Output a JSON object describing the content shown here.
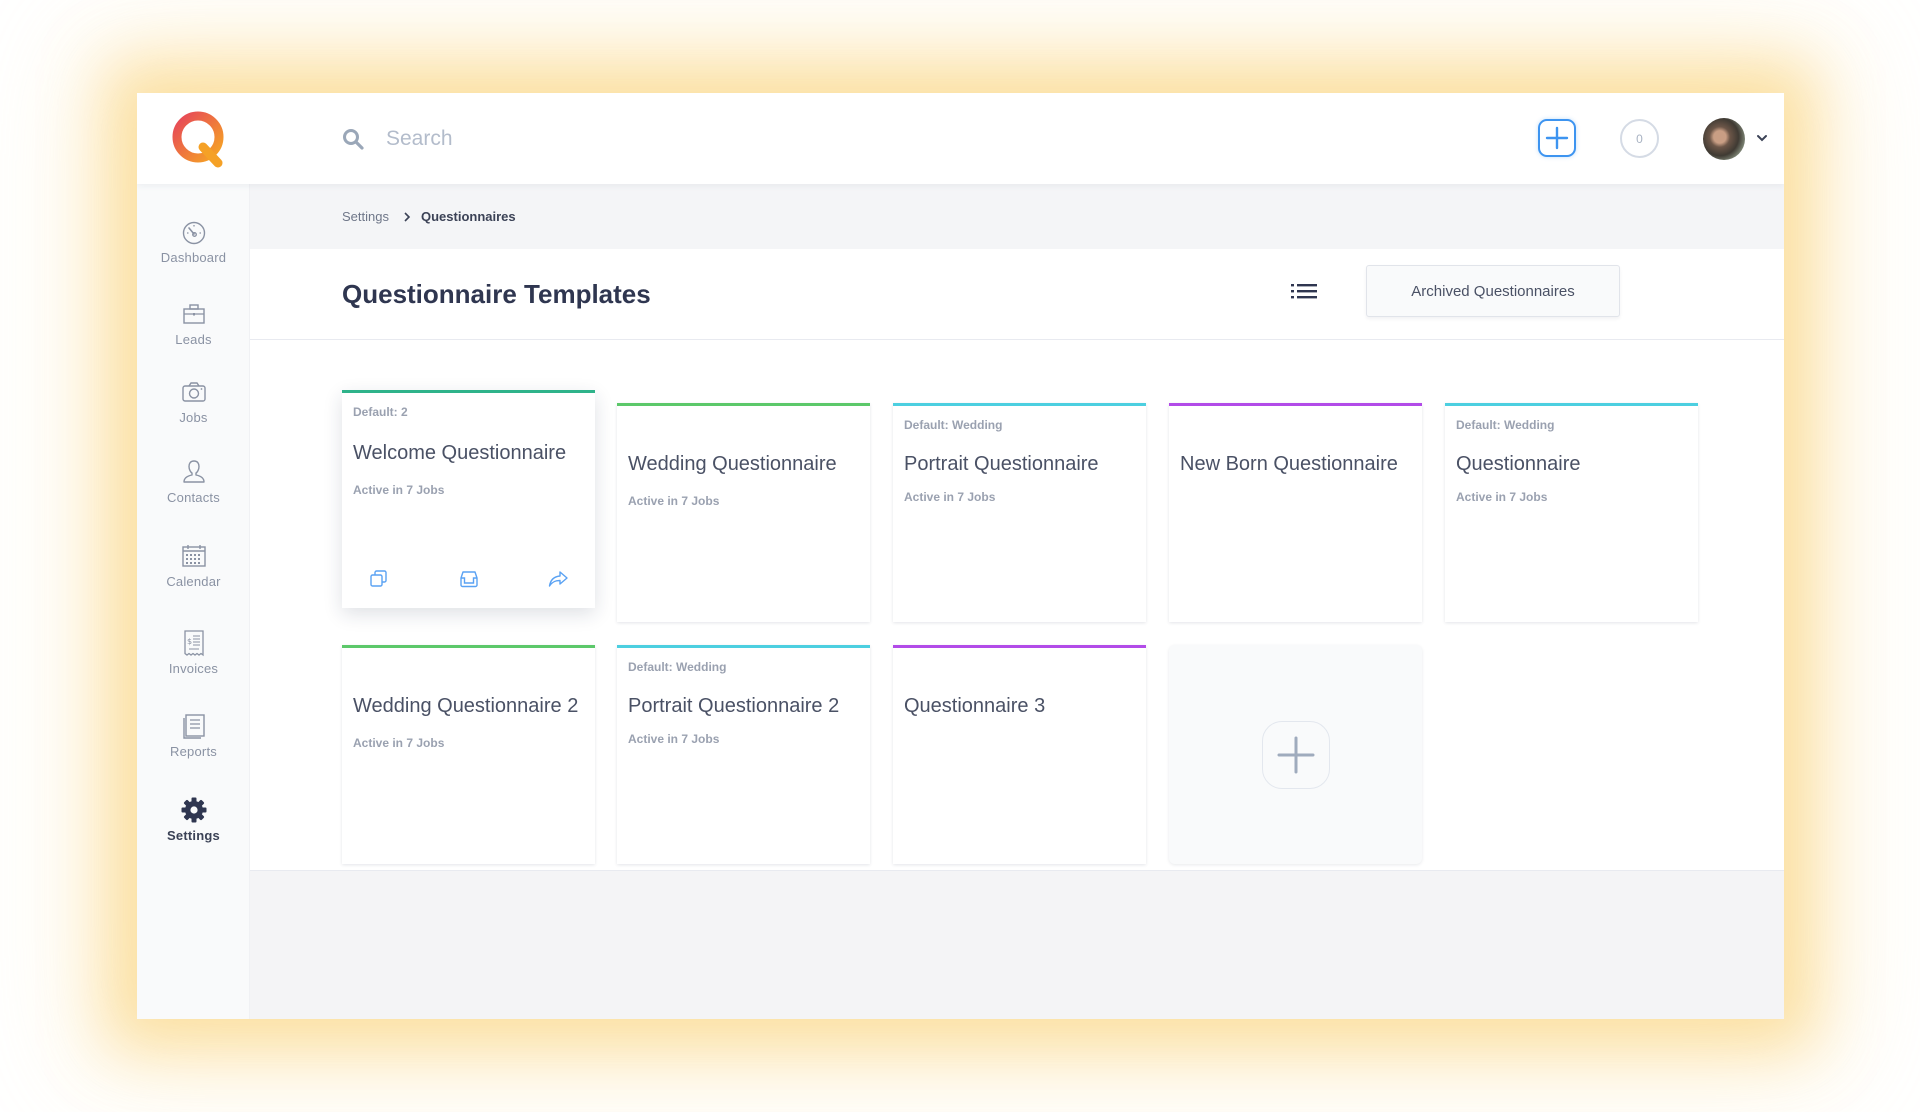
{
  "header": {
    "search_placeholder": "Search",
    "notification_count": "0",
    "add_button_icon": "plus-icon",
    "avatar_icon": "user-avatar"
  },
  "sidebar": {
    "items": [
      {
        "label": "Dashboard",
        "icon": "dashboard-gauge-icon",
        "active": false
      },
      {
        "label": "Leads",
        "icon": "briefcase-icon",
        "active": false
      },
      {
        "label": "Jobs",
        "icon": "camera-icon",
        "active": false
      },
      {
        "label": "Contacts",
        "icon": "person-icon",
        "active": false
      },
      {
        "label": "Calendar",
        "icon": "calendar-icon",
        "active": false
      },
      {
        "label": "Invoices",
        "icon": "invoice-icon",
        "active": false
      },
      {
        "label": "Reports",
        "icon": "reports-icon",
        "active": false
      },
      {
        "label": "Settings",
        "icon": "gear-icon",
        "active": true
      }
    ]
  },
  "breadcrumb": {
    "parent": "Settings",
    "current": "Questionnaires"
  },
  "page": {
    "title": "Questionnaire Templates",
    "list_view_icon": "list-view-icon",
    "archived_button": "Archived Questionnaires"
  },
  "cards": [
    {
      "default": "Default: 2",
      "title": "Welcome Questionnaire",
      "active": "Active in 7 Jobs",
      "color": "#2fb38a",
      "hovered": true
    },
    {
      "default": "",
      "title": "Wedding Questionnaire",
      "active": "Active in 7 Jobs",
      "color": "#5cc86a",
      "hovered": false
    },
    {
      "default": "Default: Wedding",
      "title": "Portrait Questionnaire",
      "active": "Active in 7 Jobs",
      "color": "#4ccfe0",
      "hovered": false
    },
    {
      "default": "",
      "title": "New Born Questionnaire",
      "active": "",
      "color": "#b24be8",
      "hovered": false
    },
    {
      "default": "Default: Wedding",
      "title": "Questionnaire",
      "active": "Active in 7 Jobs",
      "color": "#4ccfe0",
      "hovered": false
    },
    {
      "default": "",
      "title": "Wedding Questionnaire 2",
      "active": "Active in 7 Jobs",
      "color": "#5cc86a",
      "hovered": false
    },
    {
      "default": "Default: Wedding",
      "title": "Portrait Questionnaire 2",
      "active": "Active in 7 Jobs",
      "color": "#4ccfe0",
      "hovered": false
    },
    {
      "default": "",
      "title": "Questionnaire 3",
      "active": "",
      "color": "#b24be8",
      "hovered": false
    }
  ],
  "card_actions": [
    {
      "name": "duplicate",
      "icon": "duplicate-icon"
    },
    {
      "name": "archive",
      "icon": "archive-inbox-icon"
    },
    {
      "name": "share",
      "icon": "share-icon"
    }
  ],
  "add_card": {
    "icon": "plus-icon"
  },
  "colors": {
    "accent_blue": "#3d94f0",
    "logo_gradient_start": "#e6455a",
    "logo_gradient_end": "#f6a623"
  }
}
